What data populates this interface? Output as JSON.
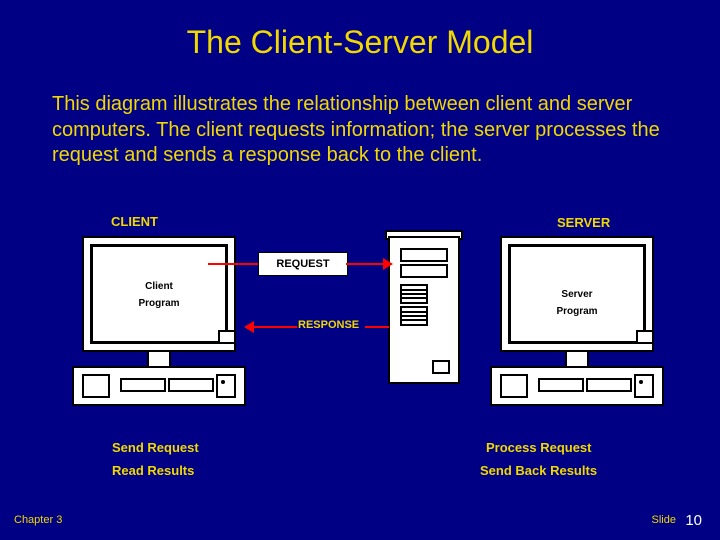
{
  "title": "The Client-Server Model",
  "body": "This diagram illustrates the relationship between client and server computers. The client requests information; the server processes the request and sends a response back to the client.",
  "labels": {
    "client_heading": "CLIENT",
    "server_heading": "SERVER",
    "request": "REQUEST",
    "response": "RESPONSE"
  },
  "client_screen": {
    "line1": "Client",
    "line2": "Program"
  },
  "server_screen": {
    "line1": "Server",
    "line2": "Program"
  },
  "captions": {
    "client1": "Send Request",
    "client2": "Read Results",
    "server1": "Process Request",
    "server2": "Send Back Results"
  },
  "footer": {
    "chapter": "Chapter  3",
    "slide_label": "Slide",
    "slide_number": "10"
  }
}
